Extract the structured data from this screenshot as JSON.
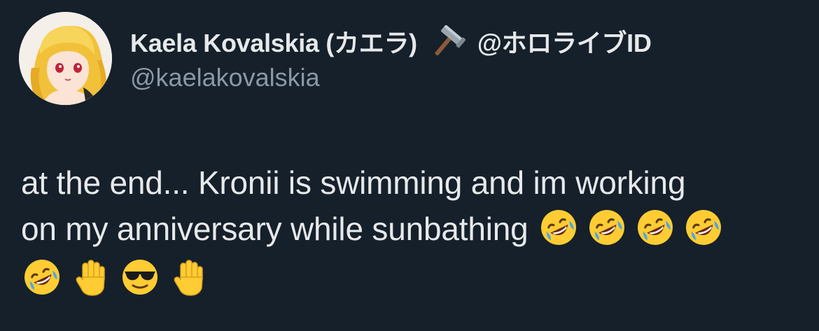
{
  "author": {
    "display_name": "Kaela Kovalskia (カエラ)",
    "name_icon": "hammer-icon",
    "name_suffix": "@ホロライブID",
    "handle": "@kaelakovalskia"
  },
  "tweet": {
    "line1": "at the end... Kronii is swimming and im working",
    "line2": "on my anniversary while sunbathing",
    "line2_emojis": [
      "rofl-emoji",
      "rofl-emoji",
      "rofl-emoji",
      "rofl-emoji"
    ],
    "line3_emojis": [
      "rofl-emoji",
      "raised-hand-emoji",
      "sunglasses-emoji",
      "raised-hand-emoji"
    ]
  },
  "colors": {
    "background": "#15202b",
    "text_primary": "#e7e9ea",
    "text_secondary": "#8b98a5",
    "emoji_yellow": "#ffcc33"
  }
}
